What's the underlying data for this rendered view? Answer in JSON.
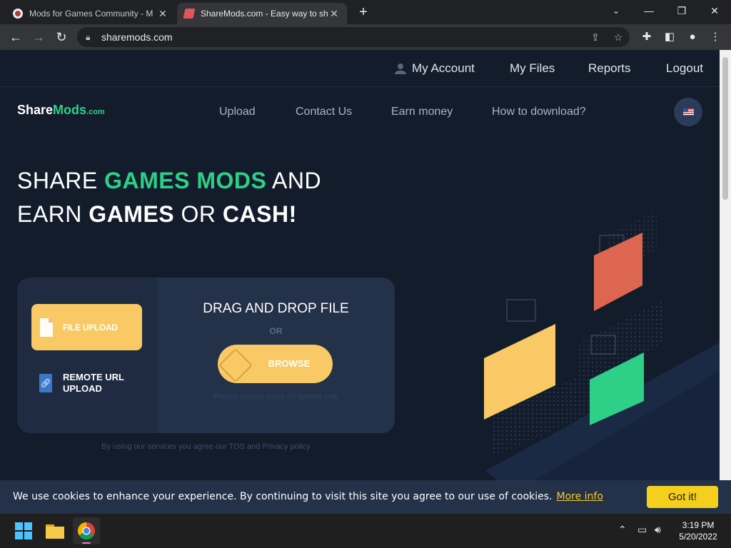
{
  "browser": {
    "tabs": [
      {
        "title": "Mods for Games Community - M",
        "active": false
      },
      {
        "title": "ShareMods.com - Easy way to sh",
        "active": true
      }
    ],
    "url": "sharemods.com"
  },
  "site": {
    "top_nav": [
      "My Account",
      "My Files",
      "Reports",
      "Logout"
    ],
    "logo": {
      "share": "Share",
      "mods": "Mods",
      "com": ".com"
    },
    "main_nav": [
      "Upload",
      "Contact Us",
      "Earn money",
      "How to download?"
    ],
    "hero": {
      "line1_a": "SHARE ",
      "line1_b": "GAMES MODS",
      "line1_c": " AND",
      "line2_a": "EARN ",
      "line2_b": "GAMES",
      "line2_c": " OR ",
      "line2_d": "CASH!"
    },
    "upload": {
      "file_upload": "FILE UPLOAD",
      "remote_url_1": "REMOTE URL",
      "remote_url_2": "UPLOAD",
      "drag_title": "DRAG AND DROP FILE",
      "or": "OR",
      "browse": "BROWSE",
      "hint": "Please upload mods for games only"
    },
    "tos": "By using our services you agree our TOS and Privacy policy",
    "colors": {
      "accent_green": "#2ecf86",
      "accent_yellow": "#f8c964",
      "bg": "#131c2b"
    }
  },
  "cookie_bar": {
    "message": "We use cookies to enhance your experience. By continuing to visit this site you agree to our use of cookies.",
    "more_info": "More info",
    "button": "Got it!"
  },
  "taskbar": {
    "time": "3:19 PM",
    "date": "5/20/2022"
  }
}
